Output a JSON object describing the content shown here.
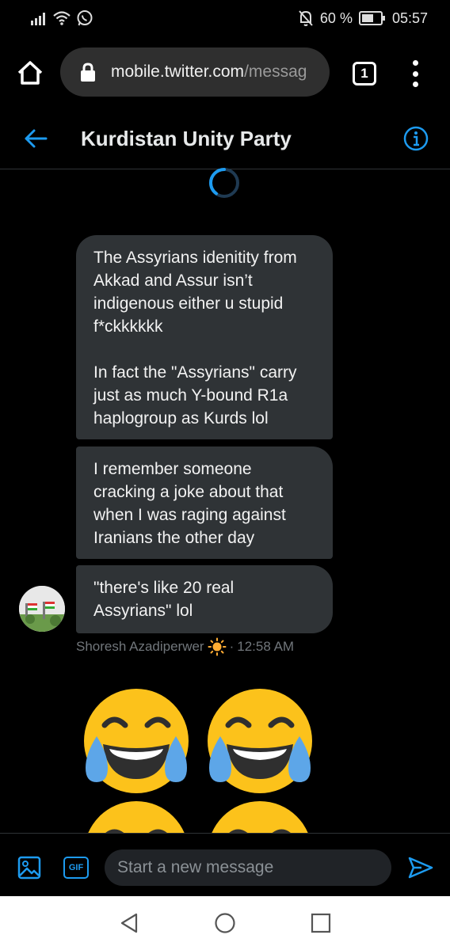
{
  "status_bar": {
    "battery_percent": "60 %",
    "time": "05:57"
  },
  "browser": {
    "url_host": "mobile.twitter.com",
    "url_path": "/messag",
    "tab_count": "1"
  },
  "conversation": {
    "title": "Kurdistan Unity Party"
  },
  "messages": [
    {
      "paragraphs": [
        [
          "The Assyrians idenitity from",
          "Akkad and Assur isn’t",
          "indigenous either u stupid",
          "f*ckkkkkk"
        ],
        [
          "In fact the \"Assyrians\" carry",
          "just as much Y-bound R1a",
          "haplogroup as Kurds lol"
        ]
      ]
    },
    {
      "paragraphs": [
        [
          "I remember someone",
          "cracking a joke about that",
          "when I was raging against",
          "Iranians the other day"
        ]
      ]
    },
    {
      "paragraphs": [
        [
          "\"there's like 20 real",
          "Assyrians\" lol"
        ]
      ]
    }
  ],
  "sender": {
    "name": "Shoresh Azadiperwer",
    "separator": "·",
    "time": "12:58 AM",
    "name_emoji": "sun-emoji"
  },
  "next_message": {
    "emojis": [
      "face-with-tears-of-joy",
      "face-with-tears-of-joy",
      "face-with-tears-of-joy",
      "face-with-tears-of-joy"
    ]
  },
  "compose": {
    "placeholder": "Start a new message",
    "gif_label": "GIF"
  },
  "colors": {
    "accent": "#1d9bf0",
    "bubble": "#2f3336",
    "emoji_yellow": "#fcc21b",
    "tear_blue": "#5da6e8"
  }
}
